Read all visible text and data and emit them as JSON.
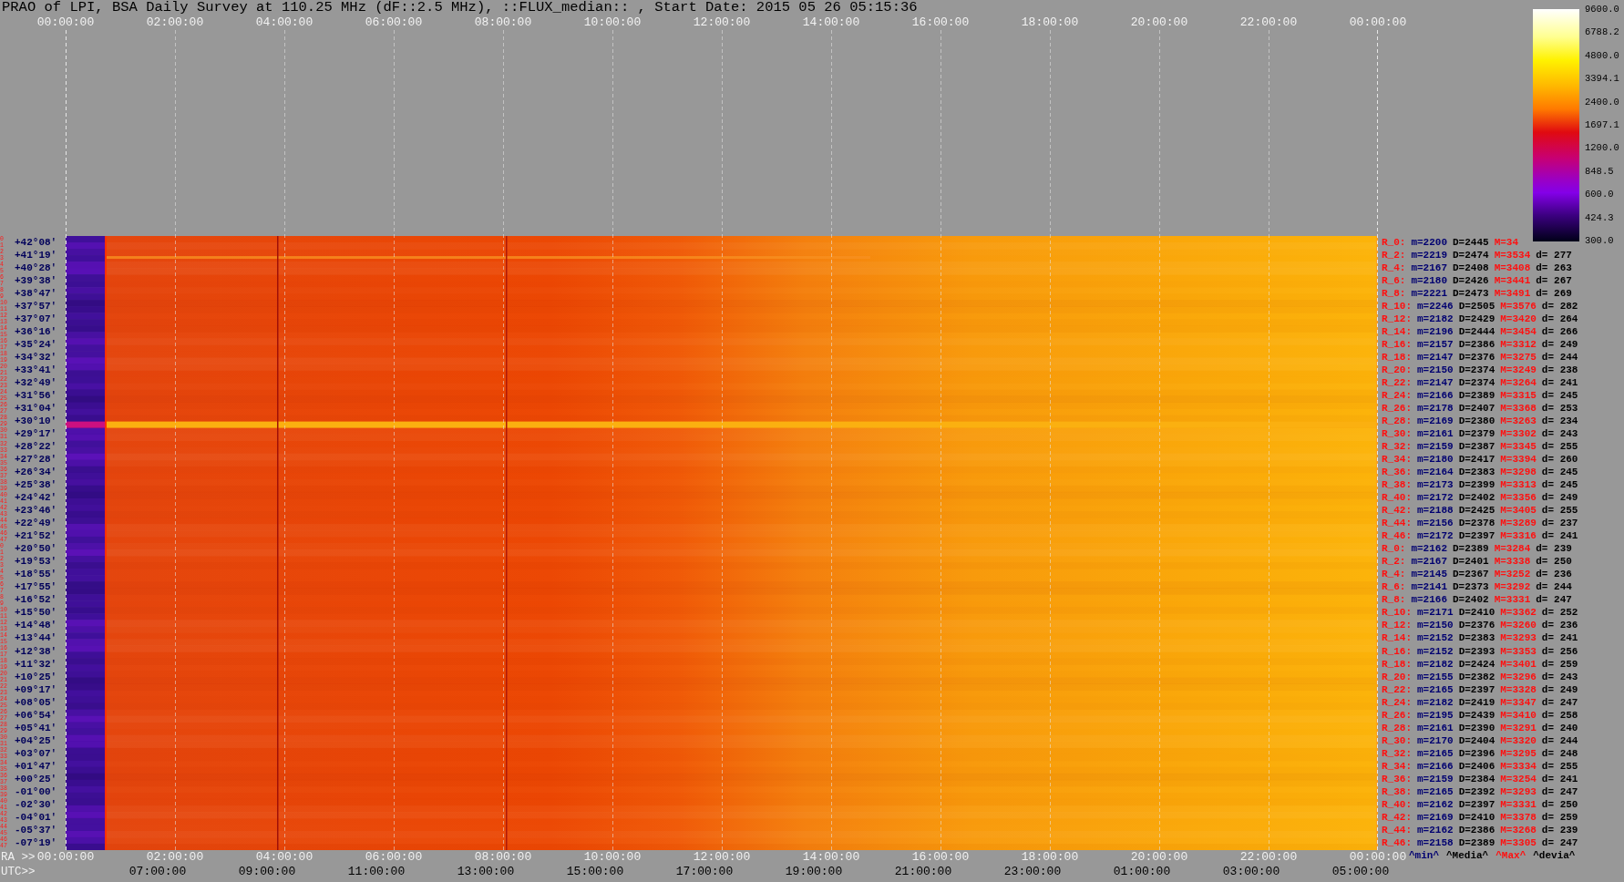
{
  "title": "PRAO of LPI, BSA Daily Survey at 110.25 MHz (dF::2.5 MHz), ::FLUX_median:: , Start Date: 2015 05 26 05:15:36",
  "top_axis": [
    "00:00:00",
    "02:00:00",
    "04:00:00",
    "06:00:00",
    "08:00:00",
    "10:00:00",
    "12:00:00",
    "14:00:00",
    "16:00:00",
    "18:00:00",
    "20:00:00",
    "22:00:00",
    "00:00:00"
  ],
  "colorbar": {
    "labels": [
      "9600.0",
      "6788.2",
      "4800.0",
      "3394.1",
      "2400.0",
      "1697.1",
      "1200.0",
      "848.5",
      "600.0",
      "424.3",
      "300.0"
    ]
  },
  "rows": [
    {
      "beams": [
        "0",
        "1"
      ],
      "declination": "+42°08′",
      "stats": {
        "label": "R_0:",
        "min": "m=2200",
        "median": "D=2445",
        "max": "M=34"
      }
    },
    {
      "beams": [
        "2",
        "3"
      ],
      "declination": "+41°19′",
      "stats": {
        "label": "R_2:",
        "min": "m=2219",
        "median": "D=2474",
        "max": "M=3534",
        "deviation": "d= 277"
      }
    },
    {
      "beams": [
        "4",
        "5"
      ],
      "declination": "+40°28′",
      "stats": {
        "label": "R_4:",
        "min": "m=2167",
        "median": "D=2408",
        "max": "M=3408",
        "deviation": "d= 263"
      }
    },
    {
      "beams": [
        "6",
        "7"
      ],
      "declination": "+39°38′",
      "stats": {
        "label": "R_6:",
        "min": "m=2180",
        "median": "D=2426",
        "max": "M=3441",
        "deviation": "d= 267"
      }
    },
    {
      "beams": [
        "8",
        "9"
      ],
      "declination": "+38°47′",
      "stats": {
        "label": "R_8:",
        "min": "m=2221",
        "median": "D=2473",
        "max": "M=3491",
        "deviation": "d= 269"
      }
    },
    {
      "beams": [
        "10",
        "11"
      ],
      "declination": "+37°57′",
      "stats": {
        "label": "R_10:",
        "min": "m=2246",
        "median": "D=2505",
        "max": "M=3576",
        "deviation": "d= 282"
      }
    },
    {
      "beams": [
        "12",
        "13"
      ],
      "declination": "+37°07′",
      "stats": {
        "label": "R_12:",
        "min": "m=2182",
        "median": "D=2429",
        "max": "M=3420",
        "deviation": "d= 264"
      }
    },
    {
      "beams": [
        "14",
        "15"
      ],
      "declination": "+36°16′",
      "stats": {
        "label": "R_14:",
        "min": "m=2196",
        "median": "D=2444",
        "max": "M=3454",
        "deviation": "d= 266"
      }
    },
    {
      "beams": [
        "16",
        "17"
      ],
      "declination": "+35°24′",
      "stats": {
        "label": "R_16:",
        "min": "m=2157",
        "median": "D=2386",
        "max": "M=3312",
        "deviation": "d= 249"
      }
    },
    {
      "beams": [
        "18",
        "19"
      ],
      "declination": "+34°32′",
      "stats": {
        "label": "R_18:",
        "min": "m=2147",
        "median": "D=2376",
        "max": "M=3275",
        "deviation": "d= 244"
      }
    },
    {
      "beams": [
        "20",
        "21"
      ],
      "declination": "+33°41′",
      "stats": {
        "label": "R_20:",
        "min": "m=2150",
        "median": "D=2374",
        "max": "M=3249",
        "deviation": "d= 238"
      }
    },
    {
      "beams": [
        "22",
        "23"
      ],
      "declination": "+32°49′",
      "stats": {
        "label": "R_22:",
        "min": "m=2147",
        "median": "D=2374",
        "max": "M=3264",
        "deviation": "d= 241"
      }
    },
    {
      "beams": [
        "24",
        "25"
      ],
      "declination": "+31°56′",
      "stats": {
        "label": "R_24:",
        "min": "m=2166",
        "median": "D=2389",
        "max": "M=3315",
        "deviation": "d= 245"
      }
    },
    {
      "beams": [
        "26",
        "27"
      ],
      "declination": "+31°04′",
      "stats": {
        "label": "R_26:",
        "min": "m=2178",
        "median": "D=2407",
        "max": "M=3368",
        "deviation": "d= 253"
      }
    },
    {
      "beams": [
        "28",
        "29"
      ],
      "declination": "+30°10′",
      "stats": {
        "label": "R_28:",
        "min": "m=2169",
        "median": "D=2380",
        "max": "M=3263",
        "deviation": "d= 234"
      }
    },
    {
      "beams": [
        "30",
        "31"
      ],
      "declination": "+29°17′",
      "stats": {
        "label": "R_30:",
        "min": "m=2161",
        "median": "D=2379",
        "max": "M=3302",
        "deviation": "d= 243"
      }
    },
    {
      "beams": [
        "32",
        "33"
      ],
      "declination": "+28°22′",
      "stats": {
        "label": "R_32:",
        "min": "m=2159",
        "median": "D=2387",
        "max": "M=3345",
        "deviation": "d= 255"
      }
    },
    {
      "beams": [
        "34",
        "35"
      ],
      "declination": "+27°28′",
      "stats": {
        "label": "R_34:",
        "min": "m=2180",
        "median": "D=2417",
        "max": "M=3394",
        "deviation": "d= 260"
      }
    },
    {
      "beams": [
        "36",
        "37"
      ],
      "declination": "+26°34′",
      "stats": {
        "label": "R_36:",
        "min": "m=2164",
        "median": "D=2383",
        "max": "M=3298",
        "deviation": "d= 245"
      }
    },
    {
      "beams": [
        "38",
        "39"
      ],
      "declination": "+25°38′",
      "stats": {
        "label": "R_38:",
        "min": "m=2173",
        "median": "D=2399",
        "max": "M=3313",
        "deviation": "d= 245"
      }
    },
    {
      "beams": [
        "40",
        "41"
      ],
      "declination": "+24°42′",
      "stats": {
        "label": "R_40:",
        "min": "m=2172",
        "median": "D=2402",
        "max": "M=3356",
        "deviation": "d= 249"
      }
    },
    {
      "beams": [
        "42",
        "43"
      ],
      "declination": "+23°46′",
      "stats": {
        "label": "R_42:",
        "min": "m=2188",
        "median": "D=2425",
        "max": "M=3405",
        "deviation": "d= 255"
      }
    },
    {
      "beams": [
        "44",
        "45"
      ],
      "declination": "+22°49′",
      "stats": {
        "label": "R_44:",
        "min": "m=2156",
        "median": "D=2378",
        "max": "M=3289",
        "deviation": "d= 237"
      }
    },
    {
      "beams": [
        "46",
        "47"
      ],
      "declination": "+21°52′",
      "stats": {
        "label": "R_46:",
        "min": "m=2172",
        "median": "D=2397",
        "max": "M=3316",
        "deviation": "d= 241"
      }
    },
    {
      "beams": [
        "0",
        "1"
      ],
      "declination": "+20°50′",
      "stats": {
        "label": "R_0:",
        "min": "m=2162",
        "median": "D=2389",
        "max": "M=3284",
        "deviation": "d= 239"
      }
    },
    {
      "beams": [
        "2",
        "3"
      ],
      "declination": "+19°53′",
      "stats": {
        "label": "R_2:",
        "min": "m=2167",
        "median": "D=2401",
        "max": "M=3338",
        "deviation": "d= 250"
      }
    },
    {
      "beams": [
        "4",
        "5"
      ],
      "declination": "+18°55′",
      "stats": {
        "label": "R_4:",
        "min": "m=2145",
        "median": "D=2367",
        "max": "M=3252",
        "deviation": "d= 236"
      }
    },
    {
      "beams": [
        "6",
        "7"
      ],
      "declination": "+17°55′",
      "stats": {
        "label": "R_6:",
        "min": "m=2141",
        "median": "D=2373",
        "max": "M=3292",
        "deviation": "d= 244"
      }
    },
    {
      "beams": [
        "8",
        "9"
      ],
      "declination": "+16°52′",
      "stats": {
        "label": "R_8:",
        "min": "m=2166",
        "median": "D=2402",
        "max": "M=3331",
        "deviation": "d= 247"
      }
    },
    {
      "beams": [
        "10",
        "11"
      ],
      "declination": "+15°50′",
      "stats": {
        "label": "R_10:",
        "min": "m=2171",
        "median": "D=2410",
        "max": "M=3362",
        "deviation": "d= 252"
      }
    },
    {
      "beams": [
        "12",
        "13"
      ],
      "declination": "+14°48′",
      "stats": {
        "label": "R_12:",
        "min": "m=2150",
        "median": "D=2376",
        "max": "M=3260",
        "deviation": "d= 236"
      }
    },
    {
      "beams": [
        "14",
        "15"
      ],
      "declination": "+13°44′",
      "stats": {
        "label": "R_14:",
        "min": "m=2152",
        "median": "D=2383",
        "max": "M=3293",
        "deviation": "d= 241"
      }
    },
    {
      "beams": [
        "16",
        "17"
      ],
      "declination": "+12°38′",
      "stats": {
        "label": "R_16:",
        "min": "m=2152",
        "median": "D=2393",
        "max": "M=3353",
        "deviation": "d= 256"
      }
    },
    {
      "beams": [
        "18",
        "19"
      ],
      "declination": "+11°32′",
      "stats": {
        "label": "R_18:",
        "min": "m=2182",
        "median": "D=2424",
        "max": "M=3401",
        "deviation": "d= 259"
      }
    },
    {
      "beams": [
        "20",
        "21"
      ],
      "declination": "+10°25′",
      "stats": {
        "label": "R_20:",
        "min": "m=2155",
        "median": "D=2382",
        "max": "M=3296",
        "deviation": "d= 243"
      }
    },
    {
      "beams": [
        "22",
        "23"
      ],
      "declination": "+09°17′",
      "stats": {
        "label": "R_22:",
        "min": "m=2165",
        "median": "D=2397",
        "max": "M=3328",
        "deviation": "d= 249"
      }
    },
    {
      "beams": [
        "24",
        "25"
      ],
      "declination": "+08°05′",
      "stats": {
        "label": "R_24:",
        "min": "m=2182",
        "median": "D=2419",
        "max": "M=3347",
        "deviation": "d= 247"
      }
    },
    {
      "beams": [
        "26",
        "27"
      ],
      "declination": "+06°54′",
      "stats": {
        "label": "R_26:",
        "min": "m=2195",
        "median": "D=2439",
        "max": "M=3410",
        "deviation": "d= 258"
      }
    },
    {
      "beams": [
        "28",
        "29"
      ],
      "declination": "+05°41′",
      "stats": {
        "label": "R_28:",
        "min": "m=2161",
        "median": "D=2390",
        "max": "M=3291",
        "deviation": "d= 240"
      }
    },
    {
      "beams": [
        "30",
        "31"
      ],
      "declination": "+04°25′",
      "stats": {
        "label": "R_30:",
        "min": "m=2170",
        "median": "D=2404",
        "max": "M=3320",
        "deviation": "d= 244"
      }
    },
    {
      "beams": [
        "32",
        "33"
      ],
      "declination": "+03°07′",
      "stats": {
        "label": "R_32:",
        "min": "m=2165",
        "median": "D=2396",
        "max": "M=3295",
        "deviation": "d= 248"
      }
    },
    {
      "beams": [
        "34",
        "35"
      ],
      "declination": "+01°47′",
      "stats": {
        "label": "R_34:",
        "min": "m=2166",
        "median": "D=2406",
        "max": "M=3334",
        "deviation": "d= 255"
      }
    },
    {
      "beams": [
        "36",
        "37"
      ],
      "declination": "+00°25′",
      "stats": {
        "label": "R_36:",
        "min": "m=2159",
        "median": "D=2384",
        "max": "M=3254",
        "deviation": "d= 241"
      }
    },
    {
      "beams": [
        "38",
        "39"
      ],
      "declination": "-01°00′",
      "stats": {
        "label": "R_38:",
        "min": "m=2165",
        "median": "D=2392",
        "max": "M=3293",
        "deviation": "d= 247"
      }
    },
    {
      "beams": [
        "40",
        "41"
      ],
      "declination": "-02°30′",
      "stats": {
        "label": "R_40:",
        "min": "m=2162",
        "median": "D=2397",
        "max": "M=3331",
        "deviation": "d= 250"
      }
    },
    {
      "beams": [
        "42",
        "43"
      ],
      "declination": "-04°01′",
      "stats": {
        "label": "R_42:",
        "min": "m=2169",
        "median": "D=2410",
        "max": "M=3378",
        "deviation": "d= 259"
      }
    },
    {
      "beams": [
        "44",
        "45"
      ],
      "declination": "-05°37′",
      "stats": {
        "label": "R_44:",
        "min": "m=2162",
        "median": "D=2386",
        "max": "M=3268",
        "deviation": "d= 239"
      }
    },
    {
      "beams": [
        "46",
        "47"
      ],
      "declination": "-07°19′",
      "stats": {
        "label": "R_46:",
        "min": "m=2158",
        "median": "D=2389",
        "max": "M=3305",
        "deviation": "d= 247"
      }
    }
  ],
  "legend": [
    "^min^",
    "^Media^",
    "^Max^",
    "^devia^"
  ],
  "ra_axis": {
    "label": "RA >>",
    "ticks": [
      "00:00:00",
      "02:00:00",
      "04:00:00",
      "06:00:00",
      "08:00:00",
      "10:00:00",
      "12:00:00",
      "14:00:00",
      "16:00:00",
      "18:00:00",
      "20:00:00",
      "22:00:00",
      "00:00:00"
    ]
  },
  "utc_axis": {
    "label": "UTC>>",
    "ticks": [
      "07:00:00",
      "09:00:00",
      "11:00:00",
      "13:00:00",
      "15:00:00",
      "17:00:00",
      "19:00:00",
      "21:00:00",
      "23:00:00",
      "01:00:00",
      "03:00:00",
      "05:00:00"
    ]
  }
}
